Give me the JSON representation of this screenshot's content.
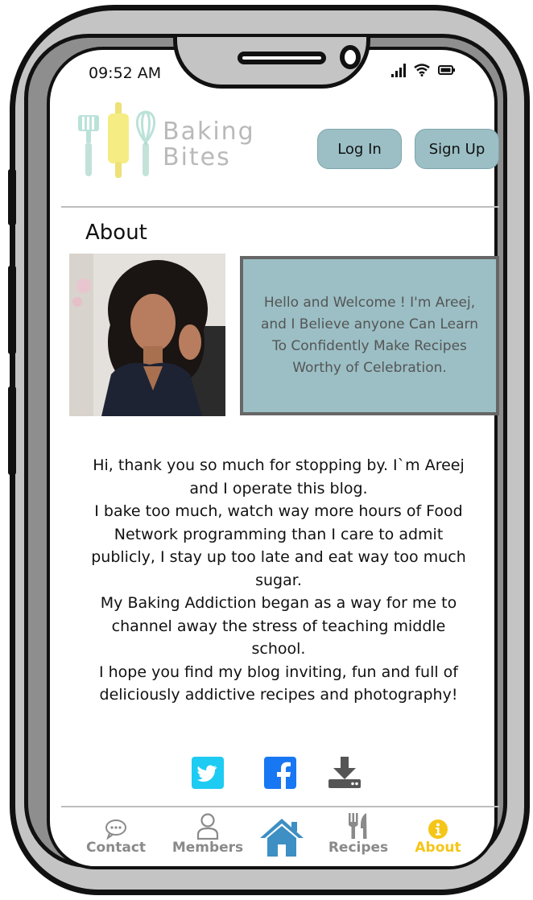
{
  "status": {
    "time": "09:52 AM"
  },
  "brand": {
    "line1": "Baking",
    "line2": "Bites"
  },
  "auth": {
    "login_label": "Log In",
    "signup_label": "Sign Up"
  },
  "about": {
    "title": "About",
    "welcome_text": "Hello and Welcome ! I'm Areej, and I Believe anyone Can  Learn To Confidently Make Recipes Worthy of Celebration.",
    "bio_lines": [
      "Hi, thank you so much for stopping by. I`m Areej",
      "and I operate this blog.",
      "I bake too much, watch way more hours of Food",
      "Network programming than I care to admit",
      "publicly, I stay up too late and eat way too much",
      "sugar.",
      "My Baking Addiction began as a way for me to",
      "channel away the stress of teaching middle",
      "school.",
      "I hope you find my blog inviting, fun and full of",
      "deliciously addictive recipes and photography!"
    ]
  },
  "social": [
    {
      "icon": "twitter-icon",
      "color": "#1ecbf2"
    },
    {
      "icon": "facebook-icon",
      "color": "#1877f2"
    },
    {
      "icon": "download-icon",
      "color": "#555555"
    }
  ],
  "tabs": [
    {
      "label": "Contact",
      "icon": "chat-icon",
      "active": false
    },
    {
      "label": "Members",
      "icon": "user-icon",
      "active": false
    },
    {
      "label": "",
      "icon": "home-icon",
      "active": false
    },
    {
      "label": "Recipes",
      "icon": "utensils-icon",
      "active": false
    },
    {
      "label": "About",
      "icon": "info-icon",
      "active": true
    }
  ],
  "colors": {
    "accent": "#9bbfc5",
    "active_tab": "#f5c518",
    "inactive_tab": "#8a8a8a",
    "home": "#3d8fc4"
  }
}
